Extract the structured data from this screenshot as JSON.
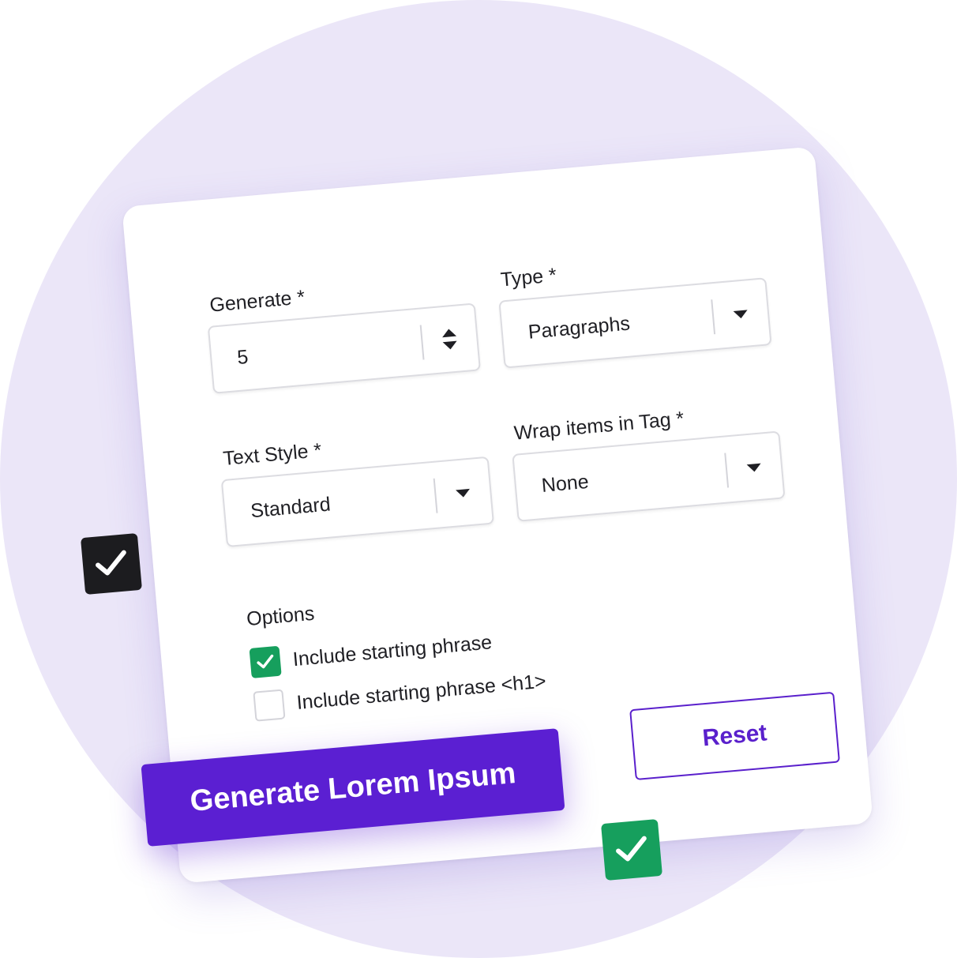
{
  "form": {
    "generate": {
      "label": "Generate *",
      "value": "5",
      "control": "number-stepper"
    },
    "type": {
      "label": "Type *",
      "value": "Paragraphs",
      "control": "dropdown"
    },
    "text_style": {
      "label": "Text Style *",
      "value": "Standard",
      "control": "dropdown"
    },
    "wrap_tag": {
      "label": "Wrap items in Tag *",
      "value": "None",
      "control": "dropdown"
    },
    "options": {
      "title": "Options",
      "items": [
        {
          "label": "Include starting phrase",
          "checked": true
        },
        {
          "label": "Include starting phrase <h1>",
          "checked": false
        }
      ]
    },
    "reset_label": "Reset",
    "generate_label": "Generate Lorem Ipsum"
  },
  "decorations": {
    "badge_dark_icon": "check-icon",
    "badge_green_icon": "check-icon"
  },
  "colors": {
    "accent": "#5b1fd2",
    "success": "#169f5d",
    "background_circle": "#ebe6f8",
    "dark_badge": "#1c1c1f"
  }
}
